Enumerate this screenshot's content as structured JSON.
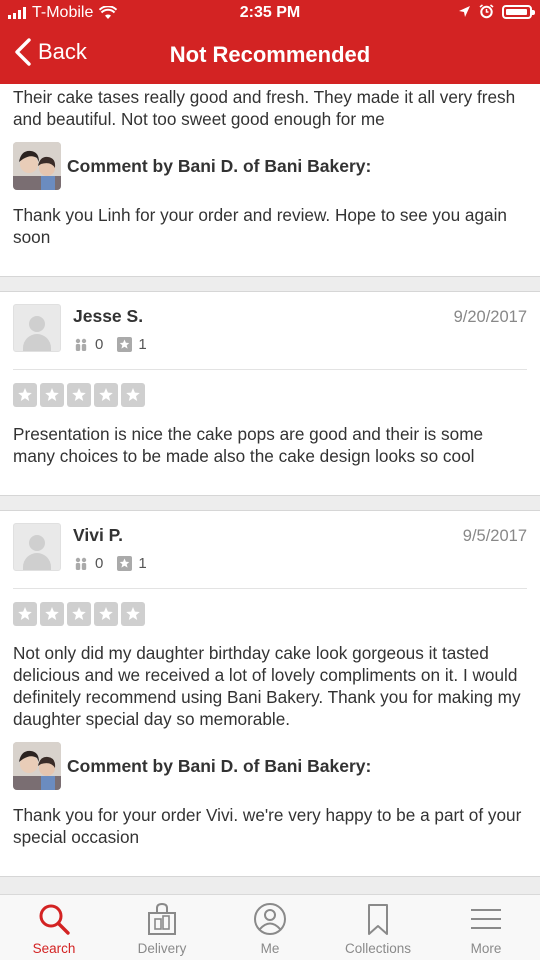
{
  "status_bar": {
    "carrier": "T-Mobile",
    "time": "2:35 PM",
    "battery_fraction": 0.95
  },
  "nav": {
    "back_label": "Back",
    "title": "Not Recommended"
  },
  "top_partial": {
    "text": "Their cake tases really good and fresh. They made it all very fresh and beautiful. Not too sweet good enough for me",
    "comment_title": "Comment by Bani D. of Bani Bakery:",
    "comment_text": "Thank you Linh for your order and review. Hope to see you again soon"
  },
  "reviews": [
    {
      "name": "Jesse S.",
      "date": "9/20/2017",
      "friends": "0",
      "reviews": "1",
      "text": "Presentation is nice the cake pops are good  and their is some many choices to be made  also the cake design looks so cool"
    },
    {
      "name": "Vivi P.",
      "date": "9/5/2017",
      "friends": "0",
      "reviews": "1",
      "text": "Not only did my daughter birthday cake look gorgeous it tasted delicious and we received a lot of lovely compliments on it. I would definitely recommend using Bani Bakery.  Thank you for making my daughter special day so memorable.",
      "comment_title": "Comment by Bani D. of Bani Bakery:",
      "comment_text": "Thank you for your order Vivi. we're very happy to be a part of your special occasion"
    }
  ],
  "tabs": [
    {
      "label": "Search",
      "icon": "search-icon",
      "active": true
    },
    {
      "label": "Delivery",
      "icon": "delivery-bag-icon",
      "active": false
    },
    {
      "label": "Me",
      "icon": "person-icon",
      "active": false
    },
    {
      "label": "Collections",
      "icon": "bookmark-icon",
      "active": false
    },
    {
      "label": "More",
      "icon": "menu-icon",
      "active": false
    }
  ],
  "colors": {
    "brand": "#d32323",
    "inactive_tab": "#8a8a8a"
  }
}
